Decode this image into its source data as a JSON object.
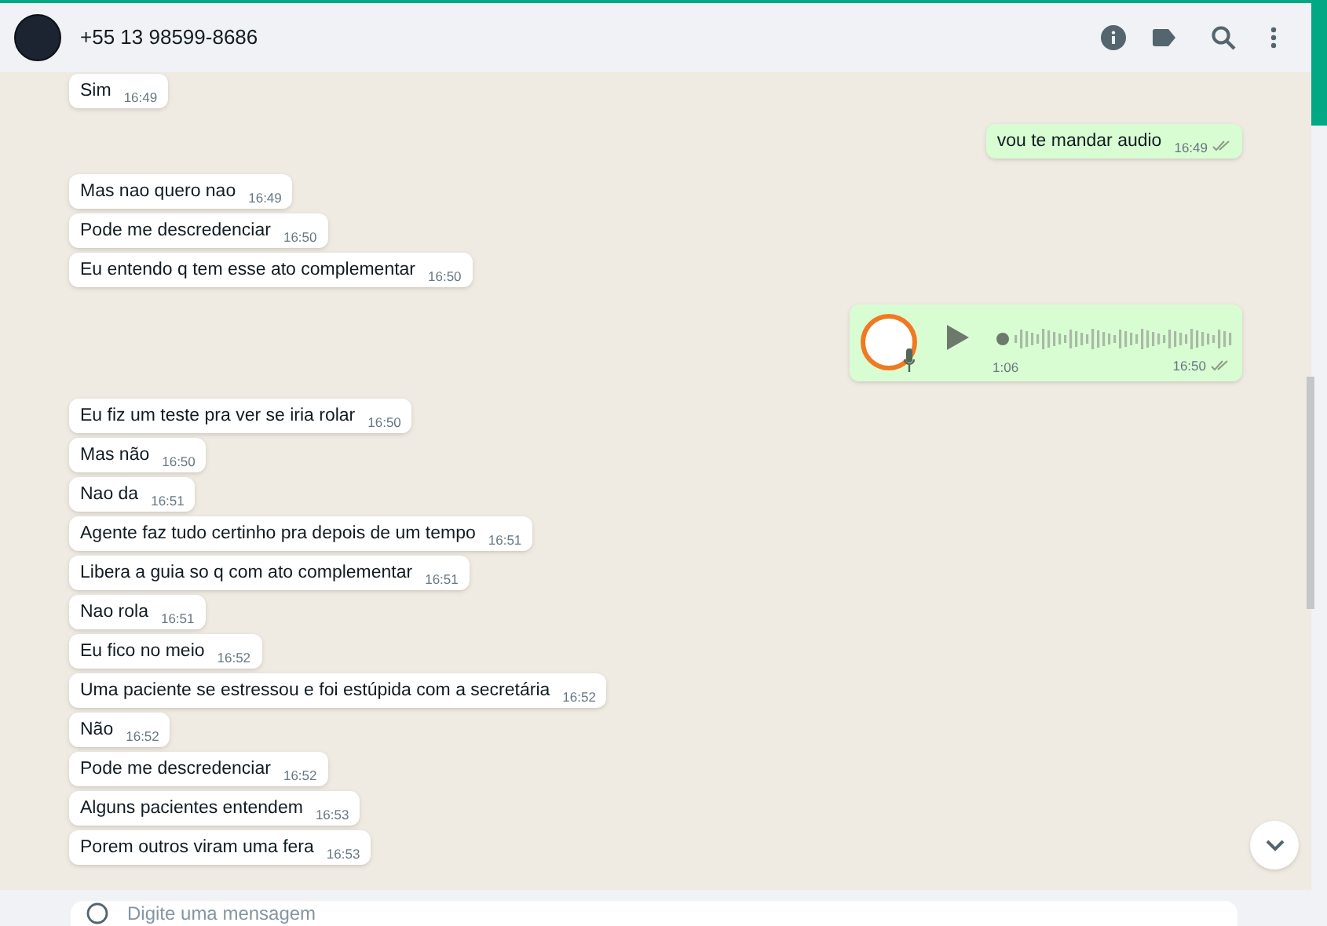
{
  "header": {
    "contact": "+55 13 98599-8686"
  },
  "messages": [
    {
      "kind": "text",
      "outgoing": false,
      "text": "Sim",
      "time": "16:49"
    },
    {
      "kind": "text",
      "outgoing": true,
      "text": "vou te mandar audio",
      "time": "16:49",
      "read": false
    },
    {
      "kind": "text",
      "outgoing": false,
      "text": "Mas nao quero nao",
      "time": "16:49"
    },
    {
      "kind": "text",
      "outgoing": false,
      "text": "Pode me descredenciar",
      "time": "16:50"
    },
    {
      "kind": "text",
      "outgoing": false,
      "text": "Eu entendo q tem esse ato complementar",
      "time": "16:50"
    },
    {
      "kind": "audio",
      "outgoing": true,
      "duration": "1:06",
      "time": "16:50",
      "read": false
    },
    {
      "kind": "text",
      "outgoing": false,
      "text": "Eu fiz um teste pra ver se iria rolar",
      "time": "16:50"
    },
    {
      "kind": "text",
      "outgoing": false,
      "text": "Mas não",
      "time": "16:50"
    },
    {
      "kind": "text",
      "outgoing": false,
      "text": "Nao da",
      "time": "16:51"
    },
    {
      "kind": "text",
      "outgoing": false,
      "text": "Agente faz tudo certinho pra depois de um tempo",
      "time": "16:51"
    },
    {
      "kind": "text",
      "outgoing": false,
      "text": "Libera a guia so q com ato complementar",
      "time": "16:51"
    },
    {
      "kind": "text",
      "outgoing": false,
      "text": "Nao rola",
      "time": "16:51"
    },
    {
      "kind": "text",
      "outgoing": false,
      "text": "Eu fico no meio",
      "time": "16:52"
    },
    {
      "kind": "text",
      "outgoing": false,
      "text": "Uma paciente se estressou e foi estúpida com a secretária",
      "time": "16:52"
    },
    {
      "kind": "text",
      "outgoing": false,
      "text": "Não",
      "time": "16:52"
    },
    {
      "kind": "text",
      "outgoing": false,
      "text": "Pode me descredenciar",
      "time": "16:52"
    },
    {
      "kind": "text",
      "outgoing": false,
      "text": "Alguns pacientes entendem",
      "time": "16:53"
    },
    {
      "kind": "text",
      "outgoing": false,
      "text": "Porem outros viram uma fera",
      "time": "16:53"
    }
  ],
  "composer": {
    "placeholder": "Digite uma mensagem"
  }
}
